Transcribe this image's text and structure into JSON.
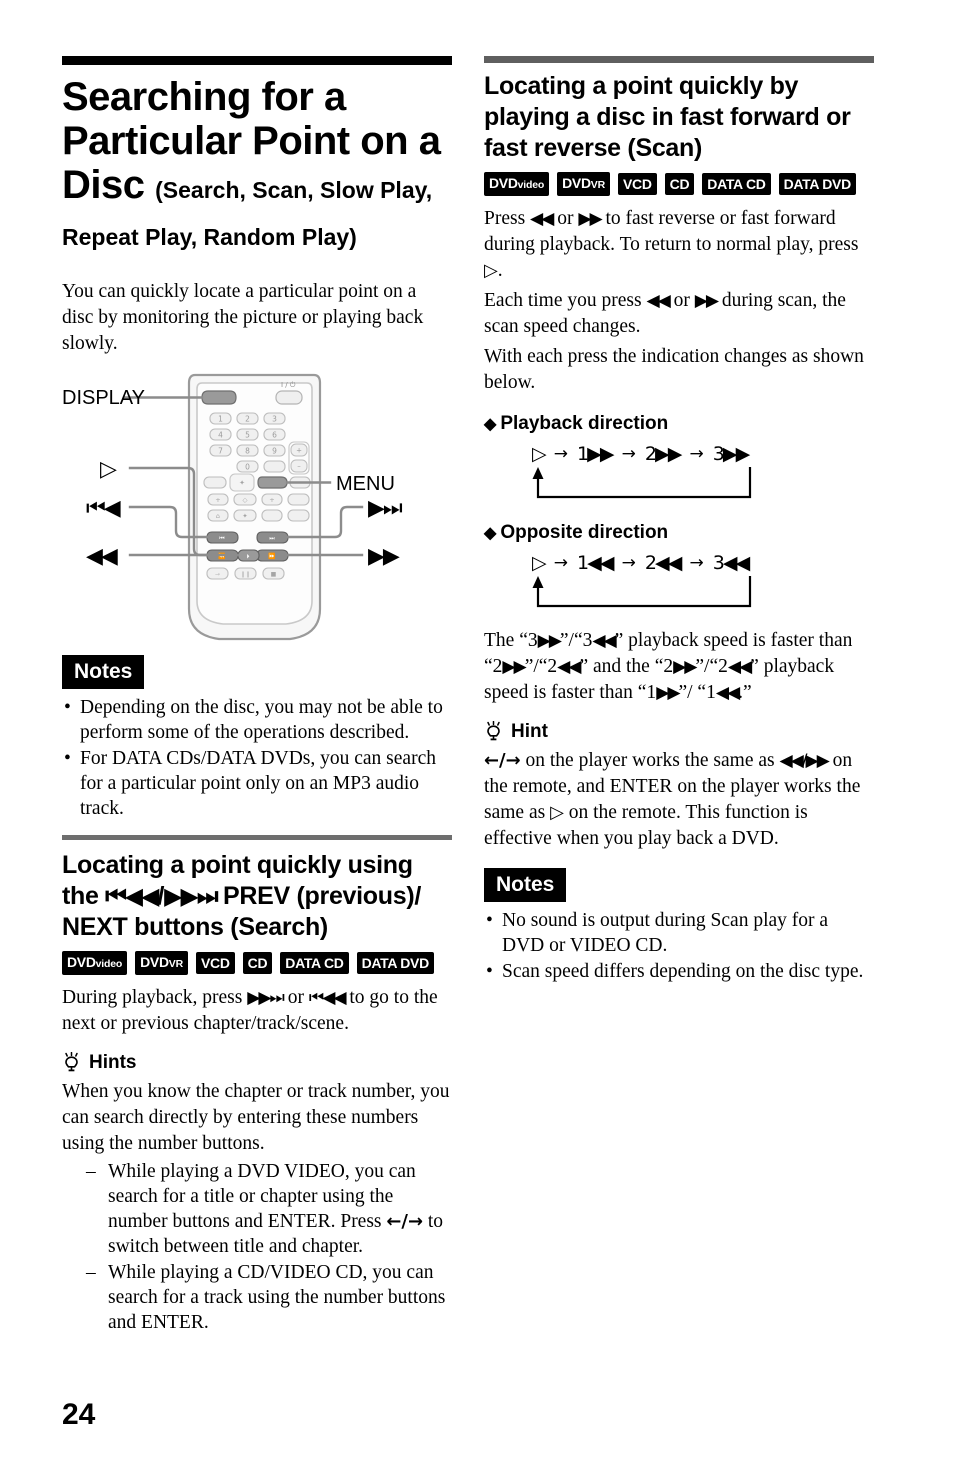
{
  "page_number": "24",
  "left_column": {
    "title_main": "Searching for a Particular Point on a Disc",
    "title_line1": "Searching for a",
    "title_line2": "Particular Point on a",
    "title_word3": "Disc",
    "title_sub1": "(Search, Scan, Slow Play,",
    "title_sub2": "Repeat Play, Random Play)",
    "intro": "You can quickly locate a particular point on a disc by monitoring the picture or playing back slowly.",
    "figure": {
      "label_display": "DISPLAY",
      "label_menu": "MENU",
      "label_play": "▷",
      "label_prev": "⏮◀◀",
      "label_next": "▶▶⏭",
      "label_rew": "◀◀",
      "label_ff": "▶▶",
      "power_label": "I/⏻",
      "keys": [
        "1",
        "2",
        "3",
        "4",
        "5",
        "6",
        "7",
        "8",
        "9",
        "0"
      ],
      "plus_label": "+",
      "minus_label": "–"
    },
    "notes_tag": "Notes",
    "notes": [
      "Depending on the disc, you may not be able to perform some of the operations described.",
      "For DATA CDs/DATA DVDs, you can search for a particular point only on an MP3 audio track."
    ],
    "section2": {
      "heading_part1": "Locating a point quickly using the ",
      "heading_prev": "⏮◀◀",
      "heading_slash": "/",
      "heading_next": "▶▶⏭",
      "heading_part2": " PREV (previous)/ NEXT buttons (Search)",
      "badges": [
        {
          "main": "DVD",
          "small": "video"
        },
        {
          "main": "DVD",
          "small": "VR"
        },
        {
          "main": "VCD",
          "small": ""
        },
        {
          "main": "CD",
          "small": ""
        },
        {
          "main": "DATA CD",
          "small": ""
        },
        {
          "main": "DATA DVD",
          "small": ""
        }
      ],
      "body_pre": "During playback, press ",
      "body_next": "▶▶⏭",
      "body_mid": " or ",
      "body_prev": "⏮◀◀",
      "body_post": " to go to the next or previous chapter/track/scene.",
      "hints_tag": "Hints",
      "hints_intro": "When you know the chapter or track number, you can search directly by entering these numbers using the number buttons.",
      "hint_items": [
        {
          "pre": "While playing a DVD VIDEO, you can search for a title or chapter using the number buttons and ENTER. Press ",
          "glyph": "←/→",
          "post": " to switch between title and chapter."
        },
        {
          "pre": "While playing a CD/VIDEO CD, you can search for a track using the number buttons and ENTER.",
          "glyph": "",
          "post": ""
        }
      ]
    }
  },
  "right_column": {
    "heading": "Locating a point quickly by playing a disc in fast forward or fast reverse (Scan)",
    "badges": [
      {
        "main": "DVD",
        "small": "video"
      },
      {
        "main": "DVD",
        "small": "VR"
      },
      {
        "main": "VCD",
        "small": ""
      },
      {
        "main": "CD",
        "small": ""
      },
      {
        "main": "DATA CD",
        "small": ""
      },
      {
        "main": "DATA DVD",
        "small": ""
      }
    ],
    "body": {
      "p1_a": "Press ",
      "p1_rew": "◀◀",
      "p1_b": " or ",
      "p1_ff": "▶▶",
      "p1_c": " to fast reverse or fast forward during playback. To return to normal play, press ",
      "p1_play": "▷",
      "p1_d": ".",
      "p2_a": "Each time you press ",
      "p2_rew": "◀◀",
      "p2_b": " or ",
      "p2_ff": "▶▶",
      "p2_c": " during scan, the scan speed changes.",
      "p3": "With each press the indication changes as shown below."
    },
    "playback_direction": {
      "heading": "Playback direction",
      "steps": [
        "▷",
        "1▶▶",
        "2▶▶",
        "3▶▶"
      ],
      "connector": "→"
    },
    "opposite_direction": {
      "heading": "Opposite direction",
      "steps": [
        "▷",
        "1◀◀",
        "2◀◀",
        "3◀◀"
      ],
      "connector": "→"
    },
    "speed_note": {
      "a": "The “3",
      "g1": "▶▶",
      "b": "”/“3",
      "g2": "◀◀",
      "c": "” playback speed is faster than “2",
      "g3": "▶▶",
      "d": "”/“2",
      "g4": "◀◀",
      "e": "” and the “2",
      "g5": "▶▶",
      "f": "”/“2",
      "g6": "◀◀",
      "g": "” playback speed is faster than “1",
      "g7": "▶▶",
      "h": "”/ “1",
      "g8": "◀◀",
      "i": ".”"
    },
    "hint": {
      "tag": "Hint",
      "a": "←/→",
      "b": " on the player works the same as ",
      "c": "◀◀/▶▶",
      "d": " on the remote, and ENTER on the player works the same as ",
      "e": "▷",
      "f": " on the remote. This function is effective when you play back a DVD."
    },
    "notes_tag": "Notes",
    "notes": [
      "No sound is output during Scan play for a DVD or VIDEO CD.",
      "Scan speed differs depending on the disc type."
    ]
  },
  "colors": {
    "rule_black": "#000000",
    "rule_gray": "#5f5f5f",
    "badge_bg": "#000000",
    "remote_body": "#f2f2f2",
    "remote_outline": "#9a9a9a",
    "remote_key": "#e8e8e8",
    "remote_key_highlight": "#8c8c8c",
    "leader_line": "#8c8c8c"
  }
}
